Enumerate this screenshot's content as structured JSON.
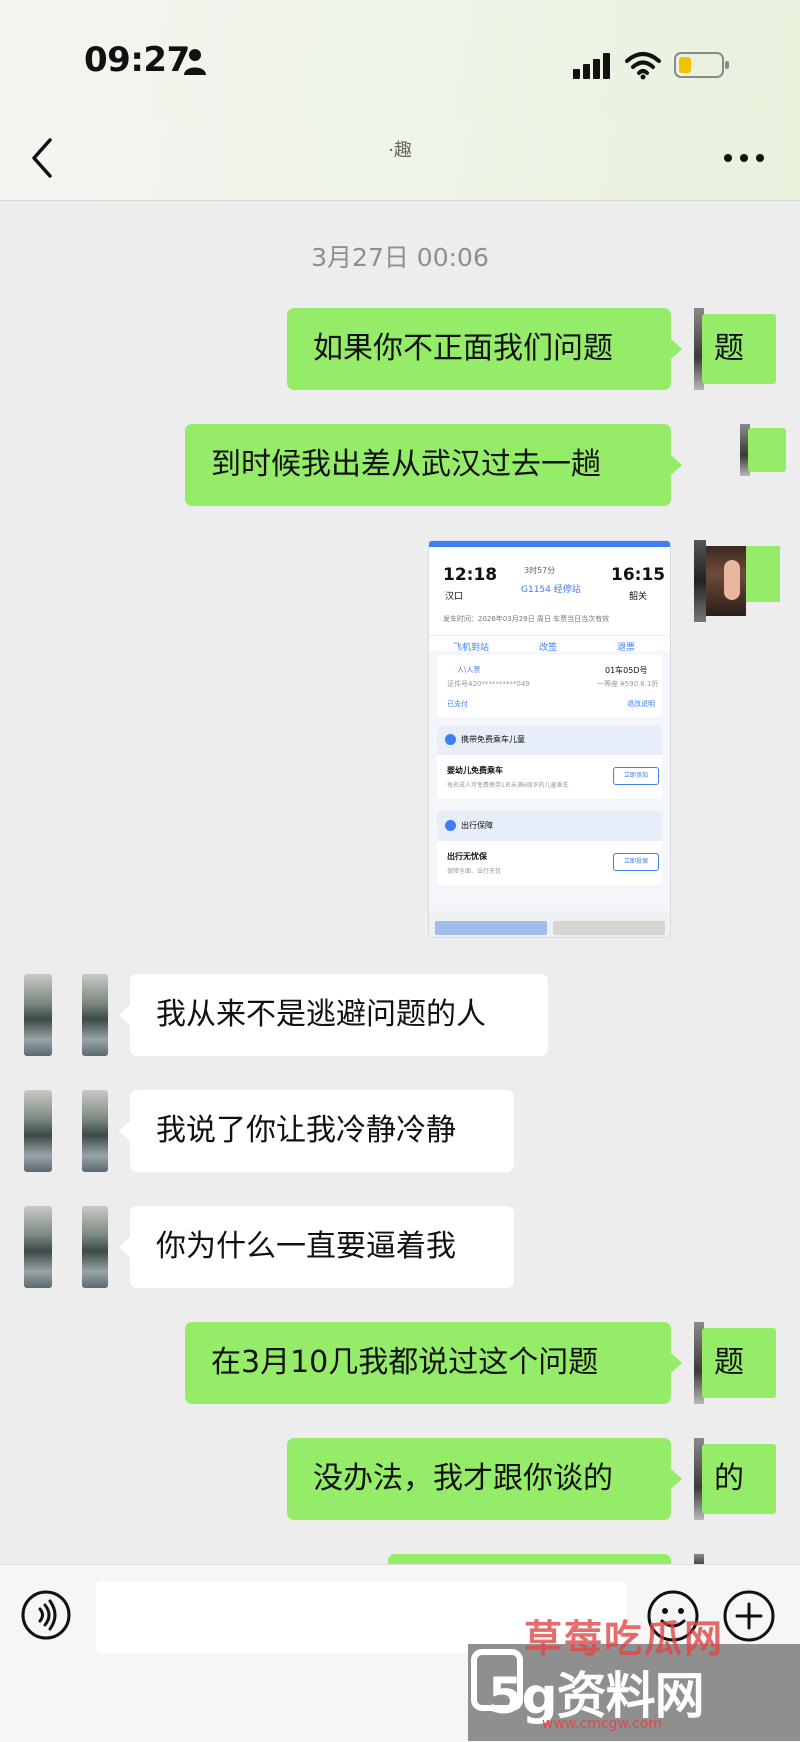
{
  "status": {
    "time": "09:27",
    "icons": [
      "person-icon",
      "signal-icon",
      "wifi-icon",
      "battery-icon"
    ]
  },
  "nav": {
    "title": "·趣",
    "back_icon": "chevron-left-icon",
    "more_icon": "more-dots-icon"
  },
  "chat": {
    "timestamp": "3月27日 00:06",
    "messages": [
      {
        "from": "self",
        "text": "如果你不正面我们问题",
        "avatar_text": "题"
      },
      {
        "from": "self",
        "text": "到时候我出差从武汉过去一趟",
        "avatar_text": ""
      },
      {
        "from": "self",
        "type": "image"
      },
      {
        "from": "other",
        "text": "我从来不是逃避问题的人"
      },
      {
        "from": "other",
        "text": "我说了你让我冷静冷静"
      },
      {
        "from": "other",
        "text": "你为什么一直要逼着我"
      },
      {
        "from": "self",
        "text": "在3月10几我都说过这个问题",
        "avatar_text": "题"
      },
      {
        "from": "self",
        "text": "没办法，我才跟你谈的",
        "avatar_text": "的"
      }
    ]
  },
  "ticket": {
    "depart_time": "12:18",
    "arrive_time": "16:15",
    "duration": "3时57分",
    "train": "G1154 经停站",
    "from_station": "汉口",
    "to_station": "韶关",
    "info": "发车时间：2026年03月29日 周日   车票当日当次有效",
    "actions": [
      "飞机到站",
      "改签",
      "退票"
    ],
    "ticket_type": "人\\人票",
    "seat": "01车05D号",
    "id_masked": "证件号420**********049",
    "price": "一等座 ¥590.6.1折",
    "paid": "已支付",
    "change_note": "退改说明",
    "card1_title": "携带免费乘车儿童",
    "card1_main": "婴幼儿免费乘车",
    "card1_sub": "每名成人可免费携带1名未满6周岁的儿童乘车",
    "card1_button": "立即添加",
    "card2_title": "出行保障",
    "card2_main": "出行无忧保",
    "card2_sub": "保障全面、出行无忧",
    "card2_button": "立即投保"
  },
  "input": {
    "placeholder": "",
    "voice_icon": "voice-icon",
    "emoji_icon": "emoji-icon",
    "plus_icon": "plus-icon"
  },
  "watermark": {
    "top": "草莓吃瓜网",
    "mid": "5g资料网",
    "url": "www.cmcgw.com"
  },
  "colors": {
    "bubble_out": "#95ec69",
    "bubble_in": "#ffffff",
    "background": "#ededed",
    "accent": "#3d7ef0"
  }
}
